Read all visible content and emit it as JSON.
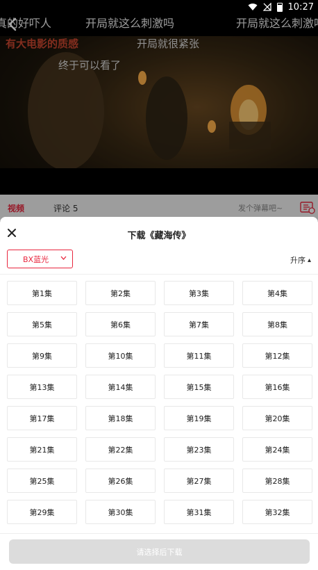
{
  "status_bar": {
    "time": "10:27"
  },
  "video": {
    "danmaku": [
      "真的好吓人",
      "开局就这么刺激吗",
      "开局就这么刺激吗",
      "有大电影的质感",
      "开局就很紧张",
      "终于可以看了"
    ]
  },
  "tabs": {
    "video_label": "视频",
    "comments_label": "评论 5",
    "danmaku_placeholder": "发个弹幕吧~"
  },
  "sheet": {
    "title": "下载《藏海传》",
    "source_label": "BX蓝光",
    "sort_label": "升序",
    "episodes": [
      "第1集",
      "第2集",
      "第3集",
      "第4集",
      "第5集",
      "第6集",
      "第7集",
      "第8集",
      "第9集",
      "第10集",
      "第11集",
      "第12集",
      "第13集",
      "第14集",
      "第15集",
      "第16集",
      "第17集",
      "第18集",
      "第19集",
      "第20集",
      "第21集",
      "第22集",
      "第23集",
      "第24集",
      "第25集",
      "第26集",
      "第27集",
      "第28集",
      "第29集",
      "第30集",
      "第31集",
      "第32集"
    ],
    "download_label": "请选择后下载"
  },
  "colors": {
    "accent": "#e8253d",
    "disabled_button": "#dcdcdc"
  }
}
